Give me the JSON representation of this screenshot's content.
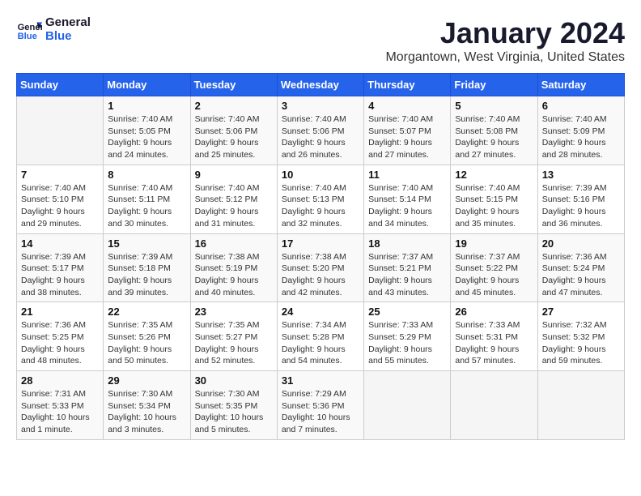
{
  "header": {
    "logo_line1": "General",
    "logo_line2": "Blue",
    "title": "January 2024",
    "subtitle": "Morgantown, West Virginia, United States"
  },
  "calendar": {
    "days_of_week": [
      "Sunday",
      "Monday",
      "Tuesday",
      "Wednesday",
      "Thursday",
      "Friday",
      "Saturday"
    ],
    "weeks": [
      [
        {
          "num": "",
          "detail": ""
        },
        {
          "num": "1",
          "detail": "Sunrise: 7:40 AM\nSunset: 5:05 PM\nDaylight: 9 hours\nand 24 minutes."
        },
        {
          "num": "2",
          "detail": "Sunrise: 7:40 AM\nSunset: 5:06 PM\nDaylight: 9 hours\nand 25 minutes."
        },
        {
          "num": "3",
          "detail": "Sunrise: 7:40 AM\nSunset: 5:06 PM\nDaylight: 9 hours\nand 26 minutes."
        },
        {
          "num": "4",
          "detail": "Sunrise: 7:40 AM\nSunset: 5:07 PM\nDaylight: 9 hours\nand 27 minutes."
        },
        {
          "num": "5",
          "detail": "Sunrise: 7:40 AM\nSunset: 5:08 PM\nDaylight: 9 hours\nand 27 minutes."
        },
        {
          "num": "6",
          "detail": "Sunrise: 7:40 AM\nSunset: 5:09 PM\nDaylight: 9 hours\nand 28 minutes."
        }
      ],
      [
        {
          "num": "7",
          "detail": "Sunrise: 7:40 AM\nSunset: 5:10 PM\nDaylight: 9 hours\nand 29 minutes."
        },
        {
          "num": "8",
          "detail": "Sunrise: 7:40 AM\nSunset: 5:11 PM\nDaylight: 9 hours\nand 30 minutes."
        },
        {
          "num": "9",
          "detail": "Sunrise: 7:40 AM\nSunset: 5:12 PM\nDaylight: 9 hours\nand 31 minutes."
        },
        {
          "num": "10",
          "detail": "Sunrise: 7:40 AM\nSunset: 5:13 PM\nDaylight: 9 hours\nand 32 minutes."
        },
        {
          "num": "11",
          "detail": "Sunrise: 7:40 AM\nSunset: 5:14 PM\nDaylight: 9 hours\nand 34 minutes."
        },
        {
          "num": "12",
          "detail": "Sunrise: 7:40 AM\nSunset: 5:15 PM\nDaylight: 9 hours\nand 35 minutes."
        },
        {
          "num": "13",
          "detail": "Sunrise: 7:39 AM\nSunset: 5:16 PM\nDaylight: 9 hours\nand 36 minutes."
        }
      ],
      [
        {
          "num": "14",
          "detail": "Sunrise: 7:39 AM\nSunset: 5:17 PM\nDaylight: 9 hours\nand 38 minutes."
        },
        {
          "num": "15",
          "detail": "Sunrise: 7:39 AM\nSunset: 5:18 PM\nDaylight: 9 hours\nand 39 minutes."
        },
        {
          "num": "16",
          "detail": "Sunrise: 7:38 AM\nSunset: 5:19 PM\nDaylight: 9 hours\nand 40 minutes."
        },
        {
          "num": "17",
          "detail": "Sunrise: 7:38 AM\nSunset: 5:20 PM\nDaylight: 9 hours\nand 42 minutes."
        },
        {
          "num": "18",
          "detail": "Sunrise: 7:37 AM\nSunset: 5:21 PM\nDaylight: 9 hours\nand 43 minutes."
        },
        {
          "num": "19",
          "detail": "Sunrise: 7:37 AM\nSunset: 5:22 PM\nDaylight: 9 hours\nand 45 minutes."
        },
        {
          "num": "20",
          "detail": "Sunrise: 7:36 AM\nSunset: 5:24 PM\nDaylight: 9 hours\nand 47 minutes."
        }
      ],
      [
        {
          "num": "21",
          "detail": "Sunrise: 7:36 AM\nSunset: 5:25 PM\nDaylight: 9 hours\nand 48 minutes."
        },
        {
          "num": "22",
          "detail": "Sunrise: 7:35 AM\nSunset: 5:26 PM\nDaylight: 9 hours\nand 50 minutes."
        },
        {
          "num": "23",
          "detail": "Sunrise: 7:35 AM\nSunset: 5:27 PM\nDaylight: 9 hours\nand 52 minutes."
        },
        {
          "num": "24",
          "detail": "Sunrise: 7:34 AM\nSunset: 5:28 PM\nDaylight: 9 hours\nand 54 minutes."
        },
        {
          "num": "25",
          "detail": "Sunrise: 7:33 AM\nSunset: 5:29 PM\nDaylight: 9 hours\nand 55 minutes."
        },
        {
          "num": "26",
          "detail": "Sunrise: 7:33 AM\nSunset: 5:31 PM\nDaylight: 9 hours\nand 57 minutes."
        },
        {
          "num": "27",
          "detail": "Sunrise: 7:32 AM\nSunset: 5:32 PM\nDaylight: 9 hours\nand 59 minutes."
        }
      ],
      [
        {
          "num": "28",
          "detail": "Sunrise: 7:31 AM\nSunset: 5:33 PM\nDaylight: 10 hours\nand 1 minute."
        },
        {
          "num": "29",
          "detail": "Sunrise: 7:30 AM\nSunset: 5:34 PM\nDaylight: 10 hours\nand 3 minutes."
        },
        {
          "num": "30",
          "detail": "Sunrise: 7:30 AM\nSunset: 5:35 PM\nDaylight: 10 hours\nand 5 minutes."
        },
        {
          "num": "31",
          "detail": "Sunrise: 7:29 AM\nSunset: 5:36 PM\nDaylight: 10 hours\nand 7 minutes."
        },
        {
          "num": "",
          "detail": ""
        },
        {
          "num": "",
          "detail": ""
        },
        {
          "num": "",
          "detail": ""
        }
      ]
    ]
  }
}
